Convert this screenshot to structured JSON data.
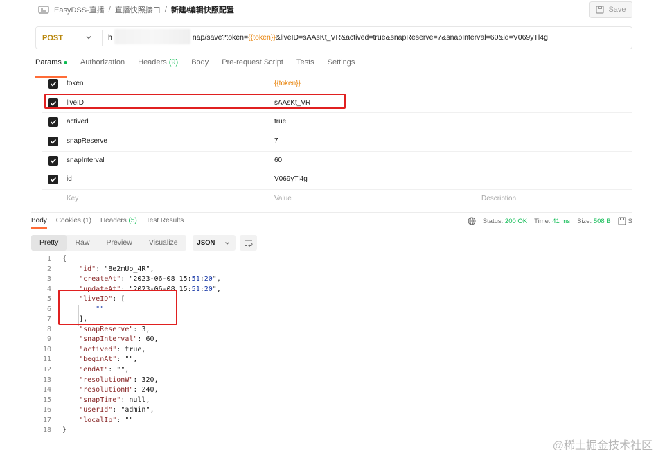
{
  "breadcrumb": {
    "items": [
      "EasyDSS-直播",
      "直播快照接口",
      "新建/编辑快照配置"
    ],
    "separator": "/"
  },
  "toolbar": {
    "save_label": "Save"
  },
  "request": {
    "method": "POST",
    "url_prefix": "h",
    "url_mid": "nap/save?token=",
    "url_token": "{{token}}",
    "url_rest": "&liveID=sAAsKt_VR&actived=true&snapReserve=7&snapInterval=60&id=V069yTl4g"
  },
  "request_tabs": [
    {
      "label": "Params",
      "active": true
    },
    {
      "label": "Authorization"
    },
    {
      "label": "Headers",
      "count": "(9)"
    },
    {
      "label": "Body"
    },
    {
      "label": "Pre-request Script"
    },
    {
      "label": "Tests"
    },
    {
      "label": "Settings"
    }
  ],
  "params": [
    {
      "key": "token",
      "value": "{{token}}",
      "checked": true
    },
    {
      "key": "liveID",
      "value": "sAAsKt_VR",
      "checked": true
    },
    {
      "key": "actived",
      "value": "true",
      "checked": true
    },
    {
      "key": "snapReserve",
      "value": "7",
      "checked": true
    },
    {
      "key": "snapInterval",
      "value": "60",
      "checked": true
    },
    {
      "key": "id",
      "value": "V069yTl4g",
      "checked": true
    }
  ],
  "params_header": {
    "key": "Key",
    "value": "Value",
    "description": "Description"
  },
  "response_tabs": [
    {
      "label": "Body",
      "active": true
    },
    {
      "label": "Cookies",
      "count": "(1)"
    },
    {
      "label": "Headers",
      "count": "(5)"
    },
    {
      "label": "Test Results"
    }
  ],
  "status": {
    "status_label": "Status:",
    "status_value": "200 OK",
    "time_label": "Time:",
    "time_value": "41 ms",
    "size_label": "Size:",
    "size_value": "508 B",
    "save_partial": "S"
  },
  "format": {
    "options": [
      "Pretty",
      "Raw",
      "Preview",
      "Visualize"
    ],
    "selected": "Pretty",
    "language": "JSON"
  },
  "code_lines": [
    "{",
    "    \"id\": \"8e2mUo_4R\",",
    "    \"createAt\": \"2023-06-08 15:51:20\",",
    "    \"updateAt\": \"2023-06-08 15:51:20\",",
    "    \"liveID\": [",
    "        \"\"",
    "    ],",
    "    \"snapReserve\": 3,",
    "    \"snapInterval\": 60,",
    "    \"actived\": true,",
    "    \"beginAt\": \"\",",
    "    \"endAt\": \"\",",
    "    \"resolutionW\": 320,",
    "    \"resolutionH\": 240,",
    "    \"snapTime\": null,",
    "    \"userId\": \"admin\",",
    "    \"localIp\": \"\"",
    "}"
  ],
  "watermark": "@稀土掘金技术社区",
  "colors": {
    "accent": "#ff6c37",
    "highlight": "#e02020",
    "method": "#b8860b",
    "success": "#0cbb52"
  }
}
